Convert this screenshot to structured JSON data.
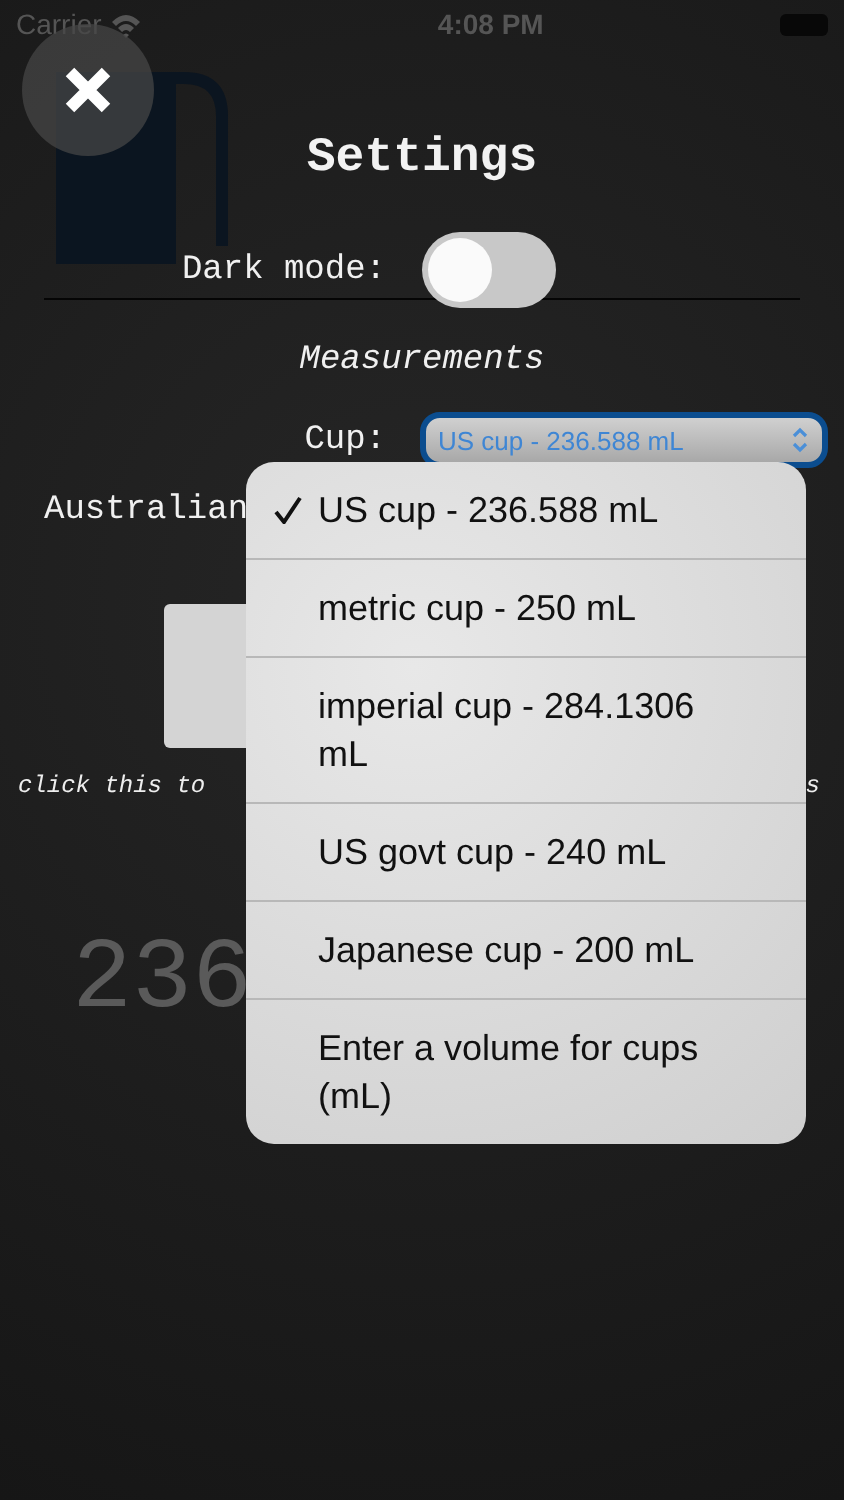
{
  "status_bar": {
    "carrier": "Carrier",
    "time": "4:08 PM"
  },
  "background": {
    "result": "236"
  },
  "settings": {
    "title": "Settings",
    "dark_mode": {
      "label": "Dark mode:",
      "on": false
    },
    "section": "Measurements",
    "cup": {
      "label": "Cup:",
      "value": "US cup - 236.588 mL"
    },
    "australian_label": "Australian",
    "hint": "click this to",
    "hint_end": "s"
  },
  "dropdown": {
    "options": [
      {
        "label": "US cup - 236.588 mL",
        "selected": true
      },
      {
        "label": "metric cup - 250 mL",
        "selected": false
      },
      {
        "label": "imperial cup - 284.1306 mL",
        "selected": false
      },
      {
        "label": "US govt cup - 240 mL",
        "selected": false
      },
      {
        "label": "Japanese cup - 200 mL",
        "selected": false
      },
      {
        "label": "Enter a volume for cups (mL)",
        "selected": false
      }
    ]
  }
}
